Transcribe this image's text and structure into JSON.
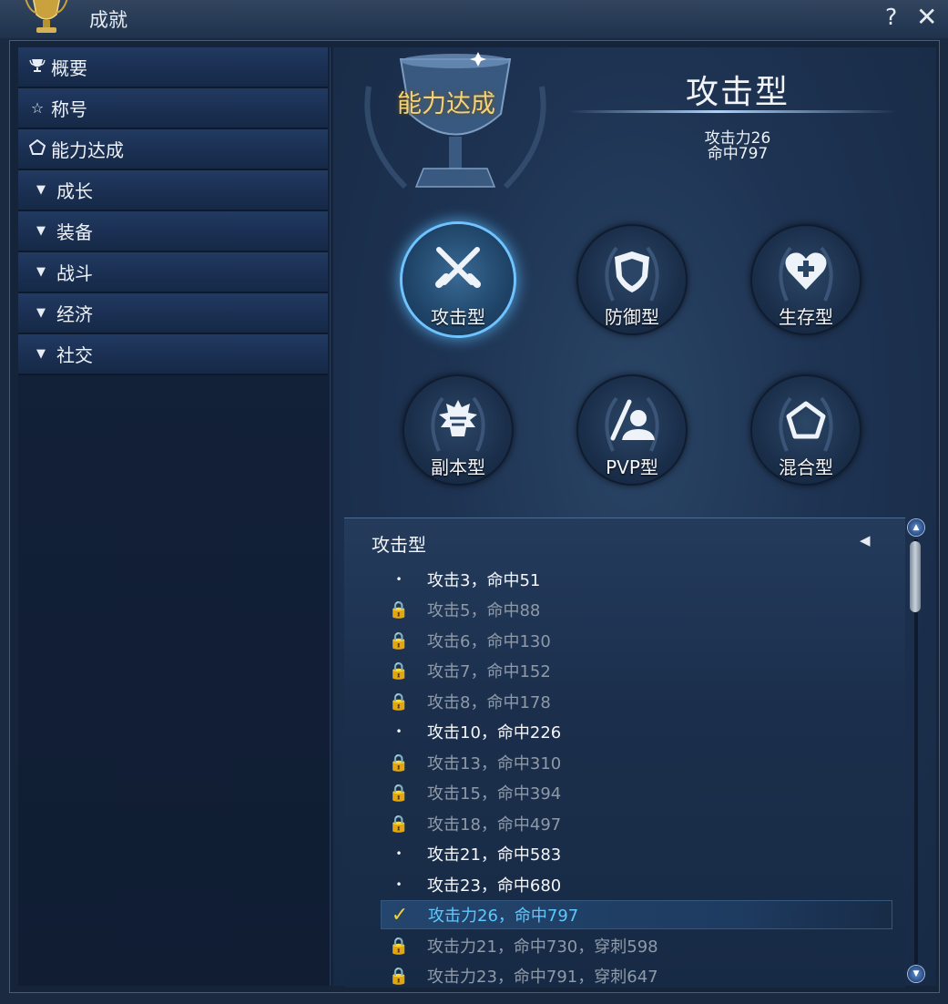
{
  "window": {
    "title": "成就",
    "help": "?",
    "close": "✕"
  },
  "sidebar": {
    "items": [
      {
        "label": "概要",
        "icon": "trophy-icon"
      },
      {
        "label": "称号",
        "icon": "star-icon"
      },
      {
        "label": "能力达成",
        "icon": "pentagon-icon"
      },
      {
        "label": "成长",
        "icon": "triangle-down-icon"
      },
      {
        "label": "装备",
        "icon": "triangle-down-icon"
      },
      {
        "label": "战斗",
        "icon": "triangle-down-icon"
      },
      {
        "label": "经济",
        "icon": "triangle-down-icon"
      },
      {
        "label": "社交",
        "icon": "triangle-down-icon"
      }
    ]
  },
  "header": {
    "section": "能力达成",
    "selected_type": "攻击型",
    "stats": [
      "攻击力26",
      "命中797"
    ]
  },
  "types": [
    {
      "label": "攻击型",
      "icon": "crossed-swords-icon",
      "selected": true
    },
    {
      "label": "防御型",
      "icon": "shield-icon"
    },
    {
      "label": "生存型",
      "icon": "heart-plus-icon"
    },
    {
      "label": "副本型",
      "icon": "monster-head-icon"
    },
    {
      "label": "PVP型",
      "icon": "pvp-fighter-icon"
    },
    {
      "label": "混合型",
      "icon": "pentagon-icon"
    }
  ],
  "list": {
    "header": "攻击型",
    "rows": [
      {
        "text": "攻击3，命中51",
        "status": "done"
      },
      {
        "text": "攻击5，命中88",
        "status": "locked"
      },
      {
        "text": "攻击6，命中130",
        "status": "locked"
      },
      {
        "text": "攻击7，命中152",
        "status": "locked"
      },
      {
        "text": "攻击8，命中178",
        "status": "locked"
      },
      {
        "text": "攻击10，命中226",
        "status": "done"
      },
      {
        "text": "攻击13，命中310",
        "status": "locked"
      },
      {
        "text": "攻击15，命中394",
        "status": "locked"
      },
      {
        "text": "攻击18，命中497",
        "status": "locked"
      },
      {
        "text": "攻击21，命中583",
        "status": "done"
      },
      {
        "text": "攻击23，命中680",
        "status": "done"
      },
      {
        "text": "攻击力26，命中797",
        "status": "checked"
      },
      {
        "text": "攻击力21，命中730，穿刺598",
        "status": "locked"
      },
      {
        "text": "攻击力23，命中791，穿刺647",
        "status": "locked"
      }
    ]
  },
  "glyphs": {
    "done": "•",
    "locked": "🔒",
    "checked": "✓",
    "collapse": "◀",
    "scroll_up": "▲",
    "scroll_down": "▼",
    "triangle": "▼"
  }
}
